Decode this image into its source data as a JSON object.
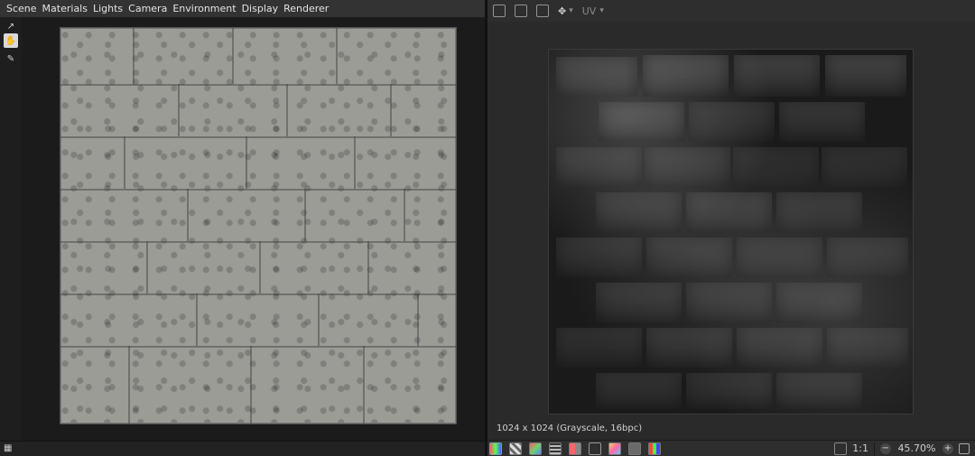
{
  "menu": {
    "items": [
      "Scene",
      "Materials",
      "Lights",
      "Camera",
      "Environment",
      "Display",
      "Renderer"
    ]
  },
  "right_toolbar": {
    "uv_label": "UV"
  },
  "texture": {
    "caption": "1024 x 1024 (Grayscale, 16bpc)"
  },
  "zoom": {
    "value": "45.70%",
    "one_to_one": "1:1"
  },
  "colors": {
    "background": "#2b2b2b",
    "menubar": "#333333",
    "viewport": "#1b1b1b"
  },
  "icons": {
    "left_tools": [
      "external-link-icon",
      "hand-pan-icon",
      "brush-icon"
    ],
    "right_toolbar": [
      "image-icon",
      "save-icon",
      "camera-icon",
      "move-icon"
    ],
    "bottom_left": [
      "grid-icon"
    ],
    "bottom_right": [
      "rgb-icon",
      "checker-icon",
      "color-icon",
      "grid-icon",
      "flag-icon",
      "info-icon",
      "palette-icon",
      "image-icon",
      "color-bars-icon",
      "fit-icon",
      "lock-icon"
    ]
  }
}
